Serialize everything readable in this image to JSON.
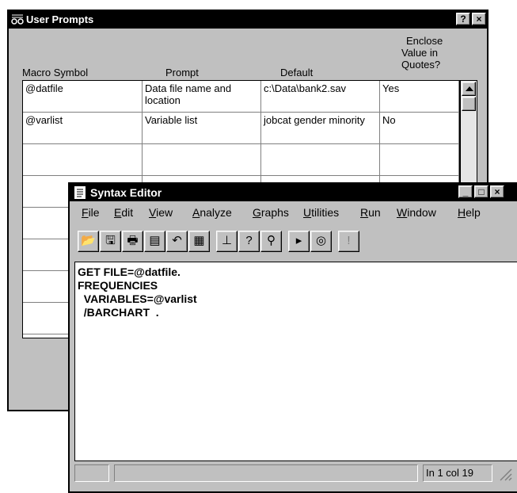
{
  "user_prompts": {
    "title": "User Prompts",
    "title_icon": "prompts-icon",
    "help_label": "?",
    "close_label": "×",
    "columns": {
      "macro_symbol": "Macro Symbol",
      "prompt": "Prompt",
      "default": "Default",
      "enclose_1": "Enclose",
      "enclose_2": "Value in",
      "enclose_3": "Quotes?"
    },
    "rows": [
      {
        "symbol": "@datfile",
        "prompt": "Data file name and location",
        "default": "c:\\Data\\bank2.sav",
        "quotes": "Yes"
      },
      {
        "symbol": "@varlist",
        "prompt": "Variable list",
        "default": "jobcat gender minority",
        "quotes": "No"
      },
      {
        "symbol": "",
        "prompt": "",
        "default": "",
        "quotes": ""
      },
      {
        "symbol": "",
        "prompt": "",
        "default": "",
        "quotes": ""
      },
      {
        "symbol": "",
        "prompt": "",
        "default": "",
        "quotes": ""
      },
      {
        "symbol": "",
        "prompt": "",
        "default": "",
        "quotes": ""
      },
      {
        "symbol": "",
        "prompt": "",
        "default": "",
        "quotes": ""
      },
      {
        "symbol": "",
        "prompt": "",
        "default": "",
        "quotes": ""
      }
    ]
  },
  "syntax_editor": {
    "title": "Syntax Editor",
    "title_icon": "syntax-document-icon",
    "window_controls": {
      "minimize": "_",
      "maximize": "□",
      "close": "×"
    },
    "menu": [
      {
        "pre": "",
        "u": "F",
        "post": "ile"
      },
      {
        "pre": "",
        "u": "E",
        "post": "dit"
      },
      {
        "pre": "",
        "u": "V",
        "post": "iew"
      },
      {
        "pre": "",
        "u": "A",
        "post": "nalyze"
      },
      {
        "pre": "",
        "u": "G",
        "post": "raphs"
      },
      {
        "pre": "",
        "u": "U",
        "post": "tilities"
      },
      {
        "pre": "",
        "u": "R",
        "post": "un"
      },
      {
        "pre": "",
        "u": "W",
        "post": "indow"
      },
      {
        "pre": "",
        "u": "H",
        "post": "elp"
      }
    ],
    "toolbar": [
      {
        "name": "open-icon",
        "glyph": "📂"
      },
      {
        "name": "save-icon",
        "glyph": "🖫"
      },
      {
        "name": "print-icon",
        "glyph": "🖶"
      },
      {
        "name": "dialog-recall-icon",
        "glyph": "▤"
      },
      {
        "name": "undo-icon",
        "glyph": "↶"
      },
      {
        "name": "goto-data-icon",
        "glyph": "▦"
      },
      {
        "name": "goto-case-icon",
        "glyph": "⊥"
      },
      {
        "name": "variables-icon",
        "glyph": "?"
      },
      {
        "name": "find-icon",
        "glyph": "⚲"
      },
      {
        "name": "run-icon",
        "glyph": "▸"
      },
      {
        "name": "use-sets-icon",
        "glyph": "◎"
      },
      {
        "name": "alert-icon",
        "glyph": "!"
      }
    ],
    "code": "GET FILE=@datfile.\nFREQUENCIES\n  VARIABLES=@varlist\n  /BARCHART  .",
    "status": {
      "position": "In 1 col 19"
    }
  }
}
